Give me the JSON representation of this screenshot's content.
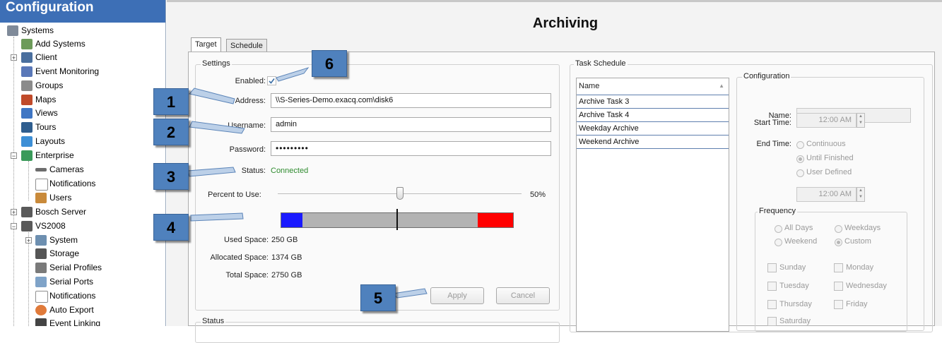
{
  "sidebar": {
    "header": "Configuration",
    "items": [
      {
        "label": "Systems",
        "icon": "systems-icon"
      },
      {
        "label": "Add Systems",
        "icon": "add-systems-icon"
      },
      {
        "label": "Client",
        "icon": "client-gear-icon"
      },
      {
        "label": "Event Monitoring",
        "icon": "event-monitoring-icon"
      },
      {
        "label": "Groups",
        "icon": "groups-icon"
      },
      {
        "label": "Maps",
        "icon": "maps-icon"
      },
      {
        "label": "Views",
        "icon": "views-icon"
      },
      {
        "label": "Tours",
        "icon": "tours-icon"
      },
      {
        "label": "Layouts",
        "icon": "layouts-icon"
      },
      {
        "label": "Enterprise",
        "icon": "enterprise-icon"
      },
      {
        "label": "Cameras",
        "icon": "cameras-icon"
      },
      {
        "label": "Notifications",
        "icon": "notifications-envelope-icon"
      },
      {
        "label": "Users",
        "icon": "users-icon"
      },
      {
        "label": "Bosch Server",
        "icon": "server-icon"
      },
      {
        "label": "VS2008",
        "icon": "server-icon"
      },
      {
        "label": "System",
        "icon": "system-icon"
      },
      {
        "label": "Storage",
        "icon": "storage-icon"
      },
      {
        "label": "Serial Profiles",
        "icon": "serial-profiles-icon"
      },
      {
        "label": "Serial Ports",
        "icon": "serial-ports-icon"
      },
      {
        "label": "Notifications",
        "icon": "notifications-envelope-icon"
      },
      {
        "label": "Auto Export",
        "icon": "auto-export-icon"
      },
      {
        "label": "Event Linking",
        "icon": "event-linking-icon"
      }
    ]
  },
  "main": {
    "title": "Archiving",
    "tabs": [
      "Target",
      "Schedule"
    ],
    "settings": {
      "group_title": "Settings",
      "enabled_label": "Enabled:",
      "enabled_checked": true,
      "address_label": "Address:",
      "address_value": "\\\\S-Series-Demo.exacq.com\\disk6",
      "username_label": "Username:",
      "username_value": "admin",
      "password_label": "Password:",
      "password_value": "•••••••••",
      "status_label": "Status:",
      "status_value": "Connected",
      "percent_label": "Percent to Use:",
      "percent_value": "50%",
      "percent_fraction": 0.5,
      "used_space_label": "Used Space:",
      "used_space_value": "250 GB",
      "allocated_space_label": "Allocated Space:",
      "allocated_space_value": "1374 GB",
      "total_space_label": "Total Space:",
      "total_space_value": "2750 GB",
      "apply_label": "Apply",
      "cancel_label": "Cancel"
    },
    "status_group_title": "Status",
    "task_schedule": {
      "group_title": "Task Schedule",
      "column_header": "Name",
      "tasks": [
        "Archive Task 3",
        "Archive Task 4",
        "Weekday Archive",
        "Weekend Archive"
      ]
    },
    "configuration": {
      "group_title": "Configuration",
      "name_label": "Name:",
      "name_value": "",
      "start_time_label": "Start Time:",
      "start_time_value": "12:00 AM",
      "end_time_label": "End Time:",
      "end_options": [
        "Continuous",
        "Until Finished",
        "User Defined"
      ],
      "end_selected": "Until Finished",
      "end_time_value": "12:00 AM",
      "frequency": {
        "group_title": "Frequency",
        "options": [
          "All Days",
          "Weekdays",
          "Weekend",
          "Custom"
        ],
        "selected": "Custom",
        "days": [
          "Sunday",
          "Monday",
          "Tuesday",
          "Wednesday",
          "Thursday",
          "Friday",
          "Saturday"
        ]
      }
    }
  },
  "callouts": [
    "1",
    "2",
    "3",
    "4",
    "5",
    "6"
  ],
  "colors": {
    "header_blue": "#3d6fb6",
    "callout_blue": "#4f81bd",
    "status_green": "#2e8b2e",
    "bar_blue": "#1a1aff",
    "bar_red": "#ff0000",
    "bar_gray": "#b3b3b3"
  }
}
